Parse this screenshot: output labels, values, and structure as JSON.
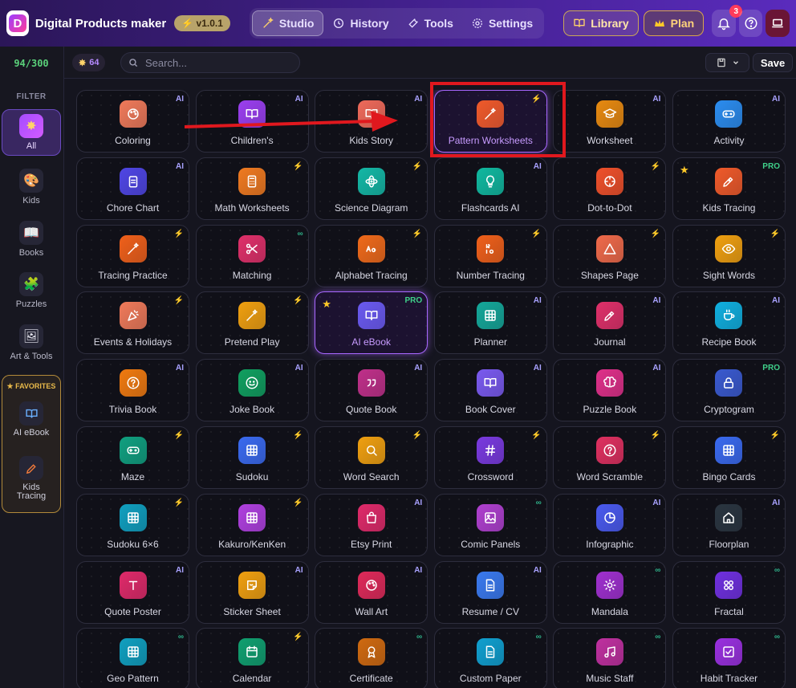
{
  "app": {
    "title": "Digital Products maker",
    "version": "v1.0.1",
    "logo_letter": "D"
  },
  "nav": [
    {
      "label": "Studio",
      "icon": "wand-icon",
      "active": true
    },
    {
      "label": "History",
      "icon": "history-icon",
      "active": false
    },
    {
      "label": "Tools",
      "icon": "wrench-icon",
      "active": false
    },
    {
      "label": "Settings",
      "icon": "gear-icon",
      "active": false
    }
  ],
  "header": {
    "library_label": "Library",
    "plan_label": "Plan",
    "notification_count": "3"
  },
  "sidebar": {
    "counter": "94/300",
    "filter_label": "FILTER",
    "items": [
      {
        "label": "All",
        "icon": "sparkle-icon",
        "glyph": "✸"
      },
      {
        "label": "Kids",
        "icon": "palette-icon",
        "glyph": "🎨"
      },
      {
        "label": "Books",
        "icon": "book-icon",
        "glyph": "📖"
      },
      {
        "label": "Puzzles",
        "icon": "puzzle-icon",
        "glyph": "🧩"
      },
      {
        "label": "Art & Tools",
        "icon": "picture-icon",
        "glyph": "🖼"
      }
    ],
    "favorites_title": "★ FAVORITES",
    "favorites": [
      {
        "label": "AI eBook",
        "icon": "book-icon"
      },
      {
        "label": "Kids Tracing",
        "icon": "pen-icon"
      }
    ]
  },
  "toolbar": {
    "credits": "64",
    "search_placeholder": "Search...",
    "save_label": "Save"
  },
  "colors": {
    "accent": "#8a4dff",
    "highlight_border": "#e0181e"
  },
  "tools": [
    {
      "label": "Coloring",
      "icon": "palette-icon",
      "color": "#f07a5a",
      "tag": "AI"
    },
    {
      "label": "Children's",
      "icon": "book-icon",
      "color": "#9b3ff0",
      "tag": "AI"
    },
    {
      "label": "Kids Story",
      "icon": "book-icon",
      "color": "#ef6a5a",
      "tag": "AI"
    },
    {
      "label": "Pattern Worksheets",
      "icon": "wand-icon",
      "color": "#f05a2a",
      "tag": "⚡",
      "highlight": true
    },
    {
      "label": "Worksheet",
      "icon": "graduation-cap-icon",
      "color": "#e88a10",
      "tag": "AI"
    },
    {
      "label": "Activity",
      "icon": "gamepad-icon",
      "color": "#2b8df0",
      "tag": "AI"
    },
    {
      "label": "Chore Chart",
      "icon": "clipboard-icon",
      "color": "#4f46e5",
      "tag": "AI"
    },
    {
      "label": "Math Worksheets",
      "icon": "calculator-icon",
      "color": "#f07a20",
      "tag": "⚡"
    },
    {
      "label": "Science Diagram",
      "icon": "atom-icon",
      "color": "#14b8a6",
      "tag": "⚡"
    },
    {
      "label": "Flashcards AI",
      "icon": "lightbulb-icon",
      "color": "#10b9a0",
      "tag": "AI"
    },
    {
      "label": "Dot-to-Dot",
      "icon": "crosshair-icon",
      "color": "#f0502a",
      "tag": "⚡"
    },
    {
      "label": "Kids Tracing",
      "icon": "pen-icon",
      "color": "#f05a2a",
      "tag": "PRO",
      "star": true
    },
    {
      "label": "Tracing Practice",
      "icon": "wand-icon",
      "color": "#f0601a",
      "tag": "⚡"
    },
    {
      "label": "Matching",
      "icon": "scissors-icon",
      "color": "#e0306a",
      "tag": "∞"
    },
    {
      "label": "Alphabet Tracing",
      "icon": "letters-icon",
      "color": "#f06a1a",
      "tag": "⚡"
    },
    {
      "label": "Number Tracing",
      "icon": "numbers-icon",
      "color": "#f0601a",
      "tag": "⚡"
    },
    {
      "label": "Shapes Page",
      "icon": "triangle-icon",
      "color": "#f06a4a",
      "tag": "⚡"
    },
    {
      "label": "Sight Words",
      "icon": "eye-icon",
      "color": "#f0a010",
      "tag": "⚡"
    },
    {
      "label": "Events & Holidays",
      "icon": "party-icon",
      "color": "#f07a5a",
      "tag": "⚡"
    },
    {
      "label": "Pretend Play",
      "icon": "wand-icon",
      "color": "#f0a010",
      "tag": "⚡"
    },
    {
      "label": "AI eBook",
      "icon": "book-icon",
      "color": "#6a5af0",
      "tag": "PRO",
      "star": true,
      "highlight": true
    },
    {
      "label": "Planner",
      "icon": "grid-icon",
      "color": "#14a89a",
      "tag": "AI"
    },
    {
      "label": "Journal",
      "icon": "pen-icon",
      "color": "#e0306a",
      "tag": "AI"
    },
    {
      "label": "Recipe Book",
      "icon": "cup-icon",
      "color": "#10b0e0",
      "tag": "AI"
    },
    {
      "label": "Trivia Book",
      "icon": "question-icon",
      "color": "#f07a10",
      "tag": "AI"
    },
    {
      "label": "Joke Book",
      "icon": "smile-icon",
      "color": "#10a060",
      "tag": "AI"
    },
    {
      "label": "Quote Book",
      "icon": "quote-icon",
      "color": "#c0308a",
      "tag": "AI"
    },
    {
      "label": "Book Cover",
      "icon": "book-icon",
      "color": "#7a5af0",
      "tag": "AI"
    },
    {
      "label": "Puzzle Book",
      "icon": "brain-icon",
      "color": "#e0308a",
      "tag": "AI"
    },
    {
      "label": "Cryptogram",
      "icon": "lock-icon",
      "color": "#3a5ad0",
      "tag": "PRO"
    },
    {
      "label": "Maze",
      "icon": "gamepad-icon",
      "color": "#10a080",
      "tag": "⚡"
    },
    {
      "label": "Sudoku",
      "icon": "grid-icon",
      "color": "#3a6af0",
      "tag": "⚡"
    },
    {
      "label": "Word Search",
      "icon": "search-icon",
      "color": "#f0a010",
      "tag": "⚡"
    },
    {
      "label": "Crossword",
      "icon": "hash-icon",
      "color": "#7a3ae0",
      "tag": "⚡"
    },
    {
      "label": "Word Scramble",
      "icon": "question-icon",
      "color": "#e03060",
      "tag": "⚡"
    },
    {
      "label": "Bingo Cards",
      "icon": "grid-icon",
      "color": "#3a6af0",
      "tag": "⚡"
    },
    {
      "label": "Sudoku 6×6",
      "icon": "grid-icon",
      "color": "#10a0c0",
      "tag": "⚡"
    },
    {
      "label": "Kakuro/KenKen",
      "icon": "grid-icon",
      "color": "#b040e0",
      "tag": "⚡"
    },
    {
      "label": "Etsy Print",
      "icon": "shopping-bag-icon",
      "color": "#e02a6a",
      "tag": "AI"
    },
    {
      "label": "Comic Panels",
      "icon": "image-icon",
      "color": "#b040d0",
      "tag": "∞"
    },
    {
      "label": "Infographic",
      "icon": "pie-chart-icon",
      "color": "#4a5af0",
      "tag": "AI"
    },
    {
      "label": "Floorplan",
      "icon": "house-icon",
      "color": "#2a3540",
      "tag": "AI"
    },
    {
      "label": "Quote Poster",
      "icon": "type-icon",
      "color": "#e02a6a",
      "tag": "AI"
    },
    {
      "label": "Sticker Sheet",
      "icon": "sticker-icon",
      "color": "#f0a010",
      "tag": "AI"
    },
    {
      "label": "Wall Art",
      "icon": "palette-icon",
      "color": "#e02a5a",
      "tag": "AI"
    },
    {
      "label": "Resume / CV",
      "icon": "document-icon",
      "color": "#3a7af0",
      "tag": "AI"
    },
    {
      "label": "Mandala",
      "icon": "sun-icon",
      "color": "#a030d0",
      "tag": "∞"
    },
    {
      "label": "Fractal",
      "icon": "flower-icon",
      "color": "#7030e0",
      "tag": "∞"
    },
    {
      "label": "Geo Pattern",
      "icon": "grid-icon",
      "color": "#10a0c0",
      "tag": "∞"
    },
    {
      "label": "Calendar",
      "icon": "calendar-icon",
      "color": "#10a070",
      "tag": "⚡"
    },
    {
      "label": "Certificate",
      "icon": "award-icon",
      "color": "#d06a10",
      "tag": "∞"
    },
    {
      "label": "Custom Paper",
      "icon": "document-icon",
      "color": "#10a0d0",
      "tag": "∞"
    },
    {
      "label": "Music Staff",
      "icon": "music-icon",
      "color": "#c030a0",
      "tag": "∞"
    },
    {
      "label": "Habit Tracker",
      "icon": "checkbox-icon",
      "color": "#9a30e0",
      "tag": "∞"
    }
  ]
}
